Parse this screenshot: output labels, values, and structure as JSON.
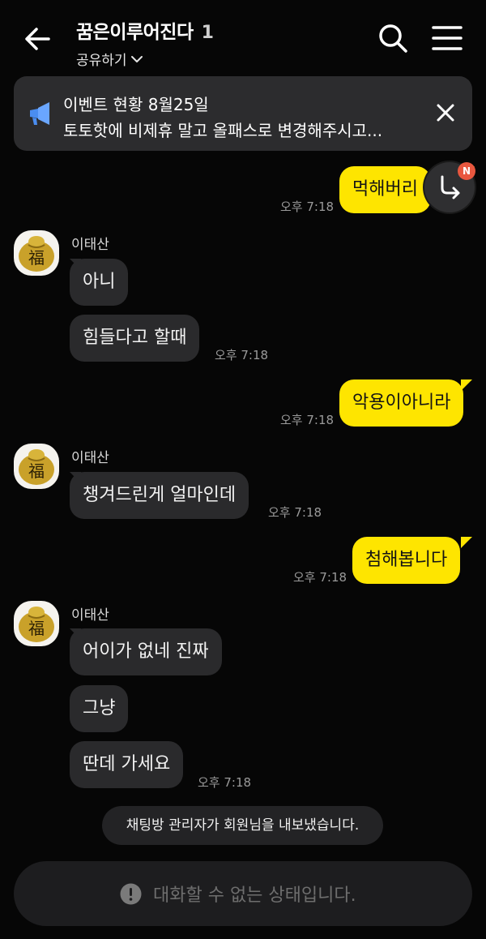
{
  "header": {
    "title": "꿈은이루어진다",
    "member_count": "1",
    "share_label": "공유하기",
    "icons": [
      "back-arrow-icon",
      "chevron-down-icon",
      "search-icon",
      "menu-icon"
    ]
  },
  "notice": {
    "title": "이벤트 현황 8월25일",
    "text": "토토핫에 비제휴 말고 올패스로 변경해주시고...",
    "icons": [
      "megaphone-icon",
      "close-icon"
    ]
  },
  "jump_button": {
    "badge": "N",
    "icon": "reply-arrow-icon"
  },
  "messages": [
    {
      "id": "m1",
      "from": "me",
      "text": "먹해버리",
      "time": "오후 7:18"
    },
    {
      "id": "m2",
      "from": "other",
      "sender": "이태산",
      "text": "아니"
    },
    {
      "id": "m3",
      "from": "other",
      "text": "힘들다고 할때",
      "time": "오후 7:18"
    },
    {
      "id": "m4",
      "from": "me",
      "text": "악용이아니라",
      "time": "오후 7:18"
    },
    {
      "id": "m5",
      "from": "other",
      "sender": "이태산",
      "text": "챙겨드린게 얼마인데",
      "time": "오후 7:18"
    },
    {
      "id": "m6",
      "from": "me",
      "text": "첨해봅니다",
      "time": "오후 7:18"
    },
    {
      "id": "m7",
      "from": "other",
      "sender": "이태산",
      "text": "어이가 없네 진짜"
    },
    {
      "id": "m8",
      "from": "other",
      "text": "그냥"
    },
    {
      "id": "m9",
      "from": "other",
      "text": "딴데 가세요",
      "time": "오후 7:18"
    }
  ],
  "avatar": {
    "glyph": "福",
    "colors": {
      "gold": "#c9a12a",
      "bg": "#f5f3ee"
    }
  },
  "system_message": "채팅방 관리자가 회원님을 내보냈습니다.",
  "input": {
    "text": "대화할 수 없는 상태입니다.",
    "icon": "alert-circle-icon"
  },
  "colors": {
    "my_bubble": "#fee500",
    "other_bubble": "#2a2a2c",
    "background": "#060606",
    "badge": "#e8573f",
    "notice_icon": "#4a8df0"
  }
}
